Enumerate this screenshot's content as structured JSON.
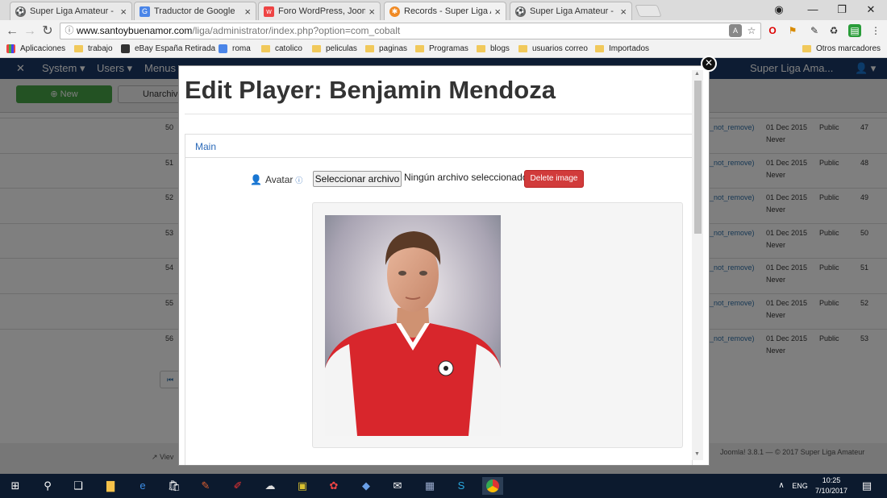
{
  "browser": {
    "tabs": [
      {
        "title": "Super Liga Amateur - Ini"
      },
      {
        "title": "Traductor de Google"
      },
      {
        "title": "Foro WordPress, Joomla"
      },
      {
        "title": "Records - Super Liga Am"
      },
      {
        "title": "Super Liga Amateur - Ini"
      }
    ],
    "url_host": "www.santoybuenamor.com",
    "url_path": "/liga/administrator/index.php?option=com_cobalt",
    "bookmarks": [
      {
        "label": "Aplicaciones"
      },
      {
        "label": "trabajo"
      },
      {
        "label": "eBay España Retirada"
      },
      {
        "label": "roma"
      },
      {
        "label": "catolico"
      },
      {
        "label": "peliculas"
      },
      {
        "label": "paginas"
      },
      {
        "label": "Programas"
      },
      {
        "label": "blogs"
      },
      {
        "label": "usuarios correo"
      },
      {
        "label": "Importados"
      },
      {
        "label": "Otros marcadores"
      }
    ]
  },
  "joomla": {
    "menu": [
      "System ▾",
      "Users ▾",
      "Menus"
    ],
    "site_name": "Super Liga Ama...",
    "new_label": "New",
    "unarchive_label": "Unarchive",
    "rows": [
      {
        "num": "50",
        "tag": "_not_remove)",
        "date": "01 Dec 2015",
        "never": "Never",
        "access": "Public",
        "id": "47"
      },
      {
        "num": "51",
        "tag": "_not_remove)",
        "date": "01 Dec 2015",
        "never": "Never",
        "access": "Public",
        "id": "48"
      },
      {
        "num": "52",
        "tag": "_not_remove)",
        "date": "01 Dec 2015",
        "never": "Never",
        "access": "Public",
        "id": "49"
      },
      {
        "num": "53",
        "tag": "_not_remove)",
        "date": "01 Dec 2015",
        "never": "Never",
        "access": "Public",
        "id": "50"
      },
      {
        "num": "54",
        "tag": "_not_remove)",
        "date": "01 Dec 2015",
        "never": "Never",
        "access": "Public",
        "id": "51"
      },
      {
        "num": "55",
        "tag": "_not_remove)",
        "date": "01 Dec 2015",
        "never": "Never",
        "access": "Public",
        "id": "52"
      },
      {
        "num": "56",
        "tag": "_not_remove)",
        "date": "01 Dec 2015",
        "never": "Never",
        "access": "Public",
        "id": "53"
      }
    ],
    "footer_left": "Viev",
    "footer_right": "Joomla! 3.8.1 — © 2017 Super Liga Amateur"
  },
  "modal": {
    "title": "Edit Player: Benjamin Mendoza",
    "tab_main": "Main",
    "avatar_label": "Avatar",
    "file_button": "Seleccionar archivo",
    "no_file": "Ningún archivo seleccionado",
    "delete_button": "Delete image"
  },
  "taskbar": {
    "lang": "ENG",
    "time": "10:25",
    "date": "7/10/2017"
  },
  "colors": {
    "joomla_nav": "#1a3867",
    "new_button": "#46a546",
    "delete_button": "#d13b3b",
    "link": "#2a69b8",
    "taskbar": "#0c1a2e"
  }
}
